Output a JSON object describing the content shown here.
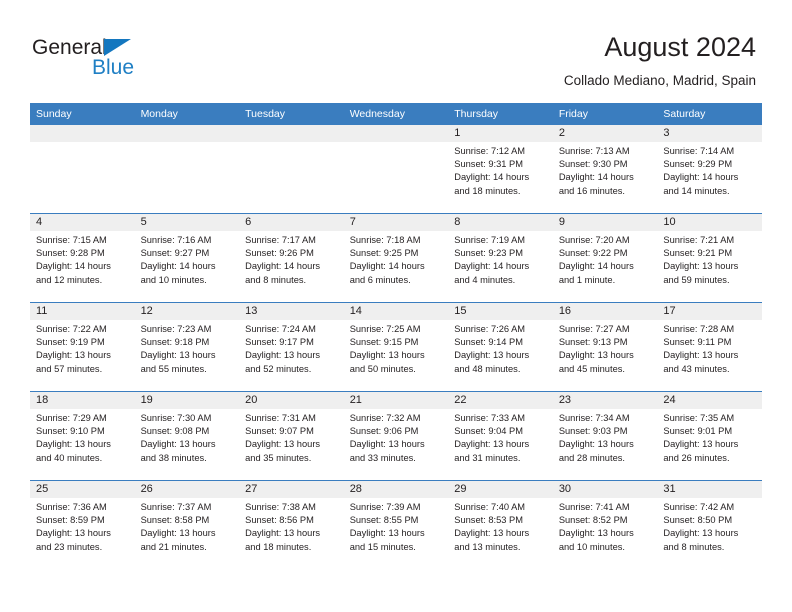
{
  "brand": {
    "name_part1": "General",
    "name_part2": "Blue",
    "triangle_color": "#1477bf",
    "blue_text_color": "#1f7fc4"
  },
  "header": {
    "title": "August 2024",
    "subtitle": "Collado Mediano, Madrid, Spain"
  },
  "theme": {
    "header_row_bg": "#3a7dbf",
    "header_row_text": "#ffffff",
    "daynum_band_bg": "#efefef",
    "week_separator": "#3a7dbf",
    "cell_bg": "#ffffff",
    "text": "#231f20"
  },
  "weekday_headers": [
    "Sunday",
    "Monday",
    "Tuesday",
    "Wednesday",
    "Thursday",
    "Friday",
    "Saturday"
  ],
  "labels": {
    "sunrise_prefix": "Sunrise:",
    "sunset_prefix": "Sunset:",
    "daylight_prefix": "Daylight:"
  },
  "weeks": [
    [
      {
        "day": "",
        "empty": true
      },
      {
        "day": "",
        "empty": true
      },
      {
        "day": "",
        "empty": true
      },
      {
        "day": "",
        "empty": true
      },
      {
        "day": "1",
        "sunrise": "Sunrise: 7:12 AM",
        "sunset": "Sunset: 9:31 PM",
        "daylight_line1": "Daylight: 14 hours",
        "daylight_line2": "and 18 minutes."
      },
      {
        "day": "2",
        "sunrise": "Sunrise: 7:13 AM",
        "sunset": "Sunset: 9:30 PM",
        "daylight_line1": "Daylight: 14 hours",
        "daylight_line2": "and 16 minutes."
      },
      {
        "day": "3",
        "sunrise": "Sunrise: 7:14 AM",
        "sunset": "Sunset: 9:29 PM",
        "daylight_line1": "Daylight: 14 hours",
        "daylight_line2": "and 14 minutes."
      }
    ],
    [
      {
        "day": "4",
        "sunrise": "Sunrise: 7:15 AM",
        "sunset": "Sunset: 9:28 PM",
        "daylight_line1": "Daylight: 14 hours",
        "daylight_line2": "and 12 minutes."
      },
      {
        "day": "5",
        "sunrise": "Sunrise: 7:16 AM",
        "sunset": "Sunset: 9:27 PM",
        "daylight_line1": "Daylight: 14 hours",
        "daylight_line2": "and 10 minutes."
      },
      {
        "day": "6",
        "sunrise": "Sunrise: 7:17 AM",
        "sunset": "Sunset: 9:26 PM",
        "daylight_line1": "Daylight: 14 hours",
        "daylight_line2": "and 8 minutes."
      },
      {
        "day": "7",
        "sunrise": "Sunrise: 7:18 AM",
        "sunset": "Sunset: 9:25 PM",
        "daylight_line1": "Daylight: 14 hours",
        "daylight_line2": "and 6 minutes."
      },
      {
        "day": "8",
        "sunrise": "Sunrise: 7:19 AM",
        "sunset": "Sunset: 9:23 PM",
        "daylight_line1": "Daylight: 14 hours",
        "daylight_line2": "and 4 minutes."
      },
      {
        "day": "9",
        "sunrise": "Sunrise: 7:20 AM",
        "sunset": "Sunset: 9:22 PM",
        "daylight_line1": "Daylight: 14 hours",
        "daylight_line2": "and 1 minute."
      },
      {
        "day": "10",
        "sunrise": "Sunrise: 7:21 AM",
        "sunset": "Sunset: 9:21 PM",
        "daylight_line1": "Daylight: 13 hours",
        "daylight_line2": "and 59 minutes."
      }
    ],
    [
      {
        "day": "11",
        "sunrise": "Sunrise: 7:22 AM",
        "sunset": "Sunset: 9:19 PM",
        "daylight_line1": "Daylight: 13 hours",
        "daylight_line2": "and 57 minutes."
      },
      {
        "day": "12",
        "sunrise": "Sunrise: 7:23 AM",
        "sunset": "Sunset: 9:18 PM",
        "daylight_line1": "Daylight: 13 hours",
        "daylight_line2": "and 55 minutes."
      },
      {
        "day": "13",
        "sunrise": "Sunrise: 7:24 AM",
        "sunset": "Sunset: 9:17 PM",
        "daylight_line1": "Daylight: 13 hours",
        "daylight_line2": "and 52 minutes."
      },
      {
        "day": "14",
        "sunrise": "Sunrise: 7:25 AM",
        "sunset": "Sunset: 9:15 PM",
        "daylight_line1": "Daylight: 13 hours",
        "daylight_line2": "and 50 minutes."
      },
      {
        "day": "15",
        "sunrise": "Sunrise: 7:26 AM",
        "sunset": "Sunset: 9:14 PM",
        "daylight_line1": "Daylight: 13 hours",
        "daylight_line2": "and 48 minutes."
      },
      {
        "day": "16",
        "sunrise": "Sunrise: 7:27 AM",
        "sunset": "Sunset: 9:13 PM",
        "daylight_line1": "Daylight: 13 hours",
        "daylight_line2": "and 45 minutes."
      },
      {
        "day": "17",
        "sunrise": "Sunrise: 7:28 AM",
        "sunset": "Sunset: 9:11 PM",
        "daylight_line1": "Daylight: 13 hours",
        "daylight_line2": "and 43 minutes."
      }
    ],
    [
      {
        "day": "18",
        "sunrise": "Sunrise: 7:29 AM",
        "sunset": "Sunset: 9:10 PM",
        "daylight_line1": "Daylight: 13 hours",
        "daylight_line2": "and 40 minutes."
      },
      {
        "day": "19",
        "sunrise": "Sunrise: 7:30 AM",
        "sunset": "Sunset: 9:08 PM",
        "daylight_line1": "Daylight: 13 hours",
        "daylight_line2": "and 38 minutes."
      },
      {
        "day": "20",
        "sunrise": "Sunrise: 7:31 AM",
        "sunset": "Sunset: 9:07 PM",
        "daylight_line1": "Daylight: 13 hours",
        "daylight_line2": "and 35 minutes."
      },
      {
        "day": "21",
        "sunrise": "Sunrise: 7:32 AM",
        "sunset": "Sunset: 9:06 PM",
        "daylight_line1": "Daylight: 13 hours",
        "daylight_line2": "and 33 minutes."
      },
      {
        "day": "22",
        "sunrise": "Sunrise: 7:33 AM",
        "sunset": "Sunset: 9:04 PM",
        "daylight_line1": "Daylight: 13 hours",
        "daylight_line2": "and 31 minutes."
      },
      {
        "day": "23",
        "sunrise": "Sunrise: 7:34 AM",
        "sunset": "Sunset: 9:03 PM",
        "daylight_line1": "Daylight: 13 hours",
        "daylight_line2": "and 28 minutes."
      },
      {
        "day": "24",
        "sunrise": "Sunrise: 7:35 AM",
        "sunset": "Sunset: 9:01 PM",
        "daylight_line1": "Daylight: 13 hours",
        "daylight_line2": "and 26 minutes."
      }
    ],
    [
      {
        "day": "25",
        "sunrise": "Sunrise: 7:36 AM",
        "sunset": "Sunset: 8:59 PM",
        "daylight_line1": "Daylight: 13 hours",
        "daylight_line2": "and 23 minutes."
      },
      {
        "day": "26",
        "sunrise": "Sunrise: 7:37 AM",
        "sunset": "Sunset: 8:58 PM",
        "daylight_line1": "Daylight: 13 hours",
        "daylight_line2": "and 21 minutes."
      },
      {
        "day": "27",
        "sunrise": "Sunrise: 7:38 AM",
        "sunset": "Sunset: 8:56 PM",
        "daylight_line1": "Daylight: 13 hours",
        "daylight_line2": "and 18 minutes."
      },
      {
        "day": "28",
        "sunrise": "Sunrise: 7:39 AM",
        "sunset": "Sunset: 8:55 PM",
        "daylight_line1": "Daylight: 13 hours",
        "daylight_line2": "and 15 minutes."
      },
      {
        "day": "29",
        "sunrise": "Sunrise: 7:40 AM",
        "sunset": "Sunset: 8:53 PM",
        "daylight_line1": "Daylight: 13 hours",
        "daylight_line2": "and 13 minutes."
      },
      {
        "day": "30",
        "sunrise": "Sunrise: 7:41 AM",
        "sunset": "Sunset: 8:52 PM",
        "daylight_line1": "Daylight: 13 hours",
        "daylight_line2": "and 10 minutes."
      },
      {
        "day": "31",
        "sunrise": "Sunrise: 7:42 AM",
        "sunset": "Sunset: 8:50 PM",
        "daylight_line1": "Daylight: 13 hours",
        "daylight_line2": "and 8 minutes."
      }
    ]
  ]
}
